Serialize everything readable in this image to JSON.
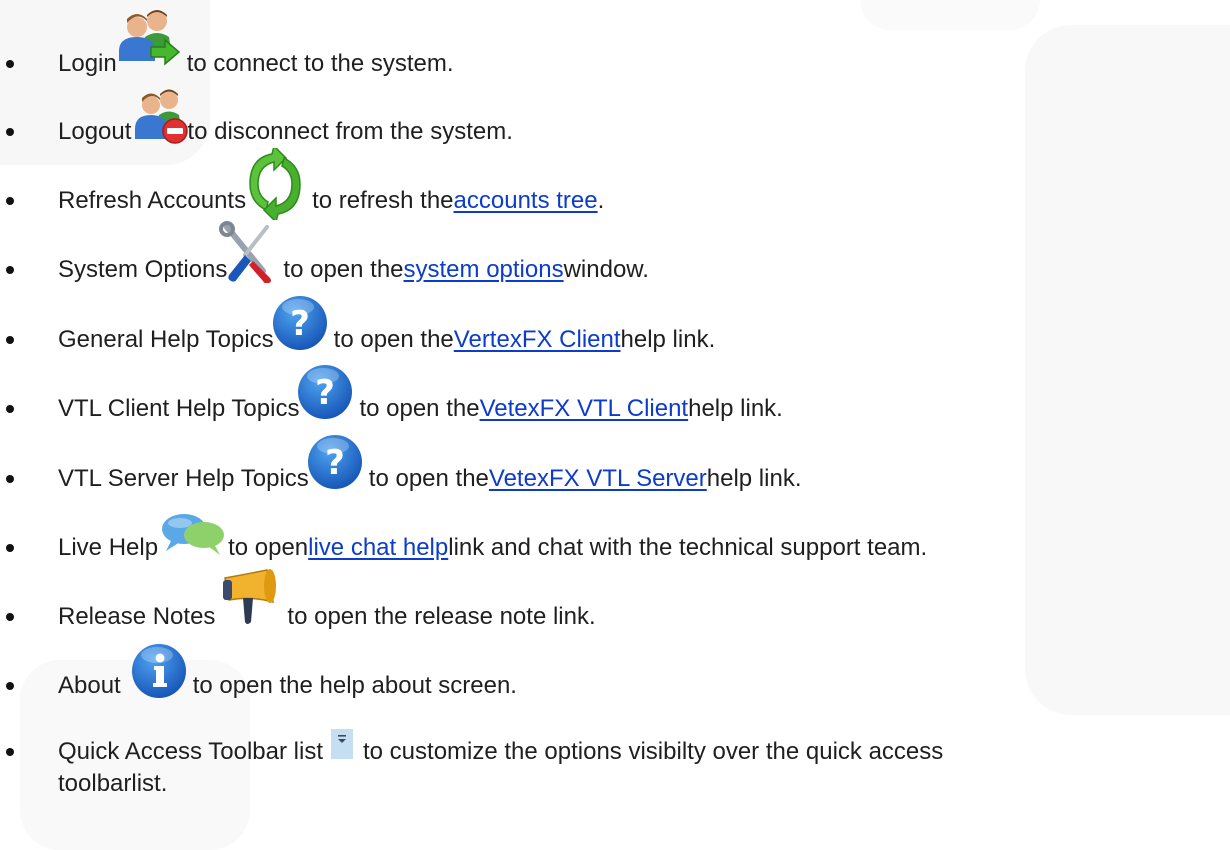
{
  "items": [
    {
      "label": "Login",
      "text": " to connect to the system."
    },
    {
      "label": "Logout",
      "text": " to disconnect from the system."
    },
    {
      "label": "Refresh Accounts",
      "text": " to refresh the ",
      "link": "accounts tree",
      "after": "."
    },
    {
      "label": "System Options",
      "text": " to open the ",
      "link": "system options",
      "after": " window."
    },
    {
      "label": "General Help Topics",
      "text": " to open the ",
      "link": "VertexFX Client",
      "after": " help link."
    },
    {
      "label": "VTL Client Help Topics",
      "text": " to open the ",
      "link": "VetexFX VTL Client",
      "after": " help link."
    },
    {
      "label": "VTL Server Help Topics",
      "text": " to open the ",
      "link": "VetexFX VTL Server",
      "after": " help link."
    },
    {
      "label": "Live Help",
      "text": " to open ",
      "link": "live chat help",
      "after": " link and chat with the technical support team."
    },
    {
      "label": "Release Notes",
      "text": " to open the release note link."
    },
    {
      "label": "About",
      "text": " to open the help about screen."
    },
    {
      "label": "Quick Access Toolbar list",
      "text": " to customize the options visibilty over the quick access",
      "line2": "toolbarlist."
    }
  ],
  "icons": {
    "login": "login-users-icon",
    "logout": "logout-users-icon",
    "refresh": "refresh-arrows-icon",
    "options": "tools-icon",
    "help": "help-question-icon",
    "chat": "chat-bubbles-icon",
    "release": "megaphone-icon",
    "about": "info-icon",
    "qat": "dropdown-arrow-icon"
  },
  "colors": {
    "link": "#0c3ccb",
    "text": "#1f1f1f",
    "help_blue": "#1e6fd0"
  }
}
